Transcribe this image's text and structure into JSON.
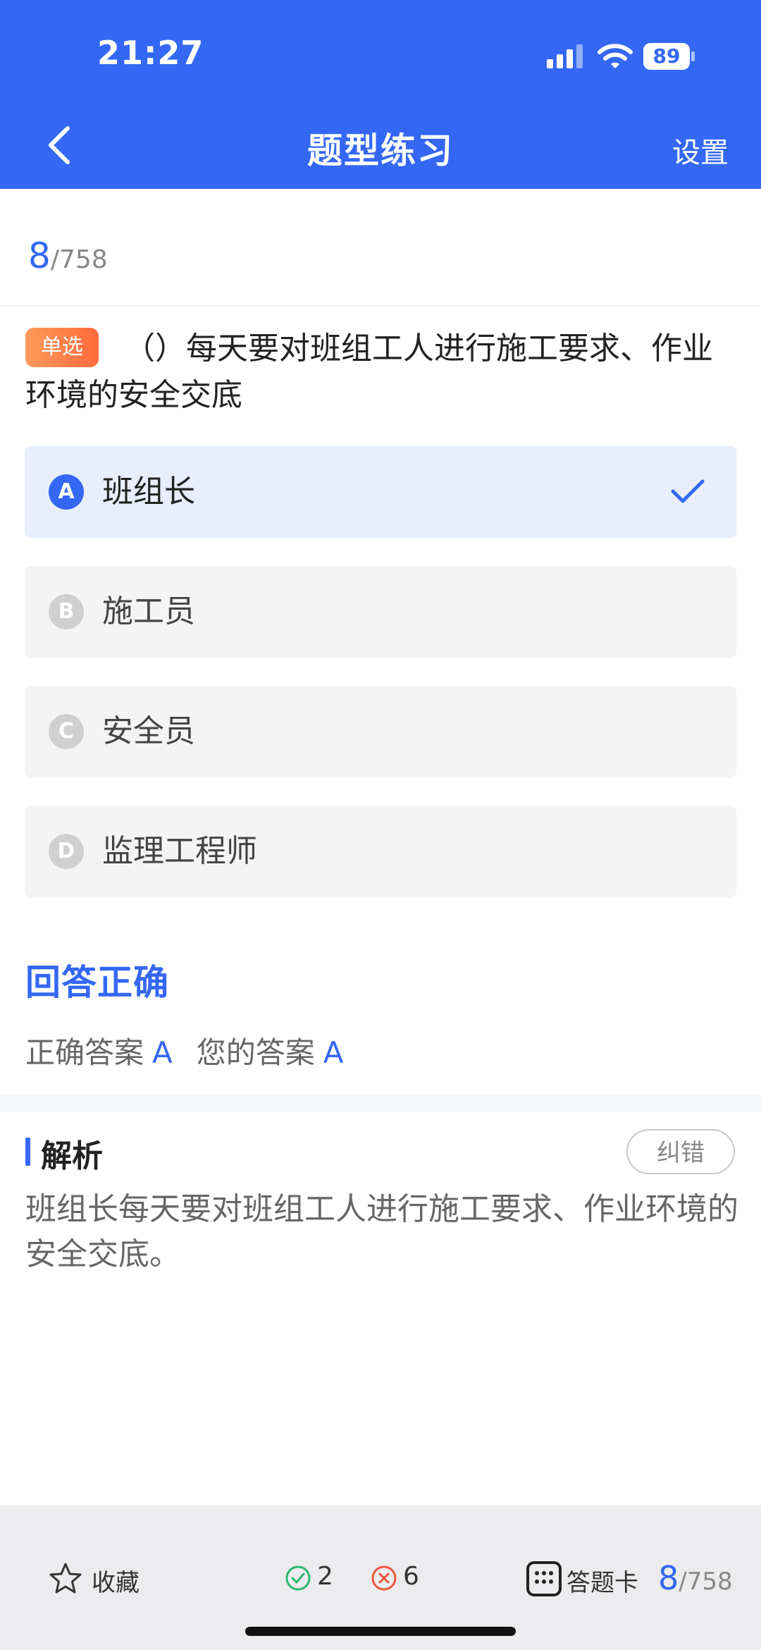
{
  "status_bar": {
    "time": "21:27",
    "battery": "89"
  },
  "header": {
    "title": "题型练习",
    "settings_label": "设置"
  },
  "progress": {
    "current": "8",
    "total": "/758"
  },
  "question": {
    "type_badge": "单选",
    "text": "（）每天要对班组工人进行施工要求、作业环境的安全交底"
  },
  "options": [
    {
      "letter": "A",
      "text": "班组长",
      "selected": true
    },
    {
      "letter": "B",
      "text": "施工员",
      "selected": false
    },
    {
      "letter": "C",
      "text": "安全员",
      "selected": false
    },
    {
      "letter": "D",
      "text": "监理工程师",
      "selected": false
    }
  ],
  "result": {
    "title": "回答正确",
    "correct_label": "正确答案",
    "correct_value": "A",
    "yours_label": "您的答案",
    "yours_value": "A"
  },
  "analysis": {
    "title": "解析",
    "report_label": "纠错",
    "text": "班组长每天要对班组工人进行施工要求、作业环境的安全交底。"
  },
  "footer": {
    "favorite_label": "收藏",
    "correct_count": "2",
    "wrong_count": "6",
    "answer_card_label": "答题卡",
    "progress_current": "8",
    "progress_total": "/758"
  },
  "colors": {
    "accent": "#3468f4",
    "badge": "#ff7a45",
    "correct": "#2bb673",
    "wrong": "#f0563c"
  }
}
